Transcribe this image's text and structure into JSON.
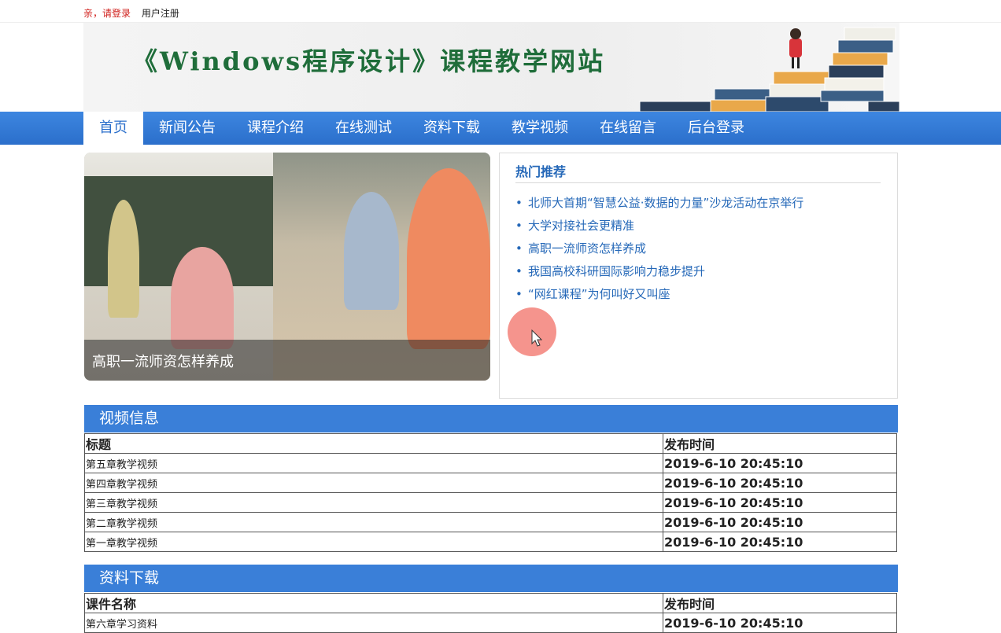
{
  "topbar": {
    "login": "亲，请登录",
    "register": "用户注册"
  },
  "banner": {
    "title": "《Windows程序设计》课程教学网站"
  },
  "nav": {
    "items": [
      "首页",
      "新闻公告",
      "课程介绍",
      "在线测试",
      "资料下载",
      "教学视频",
      "在线留言",
      "后台登录"
    ]
  },
  "slider": {
    "caption": "高职一流师资怎样养成"
  },
  "hot": {
    "title": "热门推荐",
    "items": [
      "北师大首期“智慧公益·数据的力量”沙龙活动在京举行",
      "大学对接社会更精准",
      "高职一流师资怎样养成",
      "我国高校科研国际影响力稳步提升",
      "“网红课程”为何叫好又叫座"
    ]
  },
  "video": {
    "title": "视频信息",
    "col_title": "标题",
    "col_time": "发布时间",
    "rows": [
      {
        "title": "第五章教学视频",
        "time": "2019-6-10 20:45:10"
      },
      {
        "title": "第四章教学视频",
        "time": "2019-6-10 20:45:10"
      },
      {
        "title": "第三章教学视频",
        "time": "2019-6-10 20:45:10"
      },
      {
        "title": "第二章教学视频",
        "time": "2019-6-10 20:45:10"
      },
      {
        "title": "第一章教学视频",
        "time": "2019-6-10 20:45:10"
      }
    ]
  },
  "download": {
    "title": "资料下载",
    "col_title": "课件名称",
    "col_time": "发布时间",
    "rows": [
      {
        "title": "第六章学习资料",
        "time": "2019-6-10 20:45:10"
      }
    ]
  },
  "colors": {
    "nav_blue": "#2b6fcb",
    "section_blue": "#3a7fd8",
    "link_blue": "#2568b8",
    "login_red": "#d0201c"
  },
  "icons": {
    "cursor": "cursor-pointer-icon",
    "bullet": "bullet-dot-icon"
  }
}
